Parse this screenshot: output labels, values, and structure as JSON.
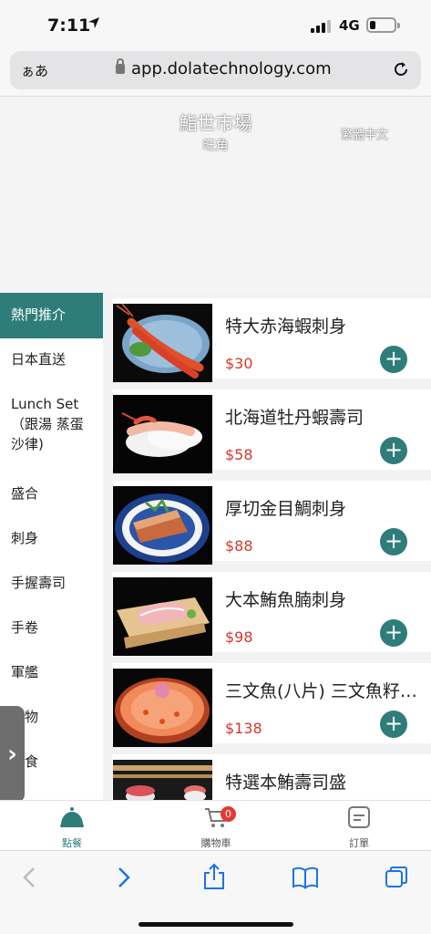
{
  "status": {
    "time": "7:11",
    "network": "4G"
  },
  "browser": {
    "aa_label": "ぁあ",
    "url": "app.dolatechnology.com"
  },
  "header": {
    "shop_name": "鮨世市場",
    "branch": "旺角",
    "language": "繁體中文"
  },
  "categories": [
    {
      "label": "熱門推介",
      "active": true
    },
    {
      "label": "日本直送"
    },
    {
      "label": "Lunch Set （跟湯 蒸蛋 沙律)"
    },
    {
      "label": "盛合"
    },
    {
      "label": "刺身"
    },
    {
      "label": "手握壽司"
    },
    {
      "label": "手卷"
    },
    {
      "label": "軍艦"
    },
    {
      "label": "揚物"
    },
    {
      "label": "定食"
    }
  ],
  "products": [
    {
      "name": "特大赤海蝦刺身",
      "price": "$30",
      "image": "shrimp-sashimi"
    },
    {
      "name": "北海道牡丹蝦壽司",
      "price": "$58",
      "image": "botan-shrimp-sushi"
    },
    {
      "name": "厚切金目鯛刺身",
      "price": "$88",
      "image": "kinmedai-sashimi"
    },
    {
      "name": "大本鮪魚腩刺身",
      "price": "$98",
      "image": "otoro-sashimi"
    },
    {
      "name": "三文魚(八片) 三文魚籽刺身",
      "price": "$138",
      "image": "salmon-plate"
    },
    {
      "name": "特選本鮪壽司盛",
      "price": "",
      "image": "tuna-sushi-set"
    }
  ],
  "tabs": [
    {
      "label": "點餐",
      "icon": "cloche-icon",
      "active": true
    },
    {
      "label": "購物車",
      "icon": "cart-icon",
      "badge": "0"
    },
    {
      "label": "訂單",
      "icon": "order-icon"
    }
  ],
  "colors": {
    "accent": "#2e7d7a",
    "price": "#d23a2a",
    "badge": "#e53935"
  }
}
